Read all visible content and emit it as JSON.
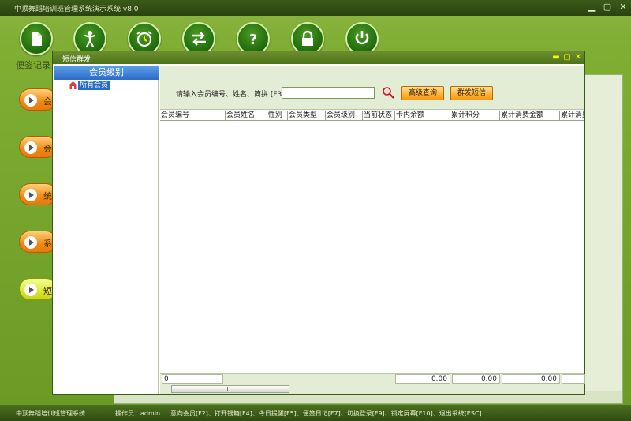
{
  "app": {
    "title": "中顶舞蹈培训班管理系统演示系统  v8.0",
    "controls": [
      "▁",
      "▢",
      "✕"
    ]
  },
  "top_icons": [
    {
      "name": "document-icon"
    },
    {
      "name": "person-icon"
    },
    {
      "name": "alarm-clock-icon"
    },
    {
      "name": "switch-arrows-icon"
    },
    {
      "name": "help-icon"
    },
    {
      "name": "lock-icon"
    },
    {
      "name": "power-icon"
    }
  ],
  "sidebar": {
    "label_top": "便签记录",
    "buttons": [
      {
        "label": "会",
        "style": "orange"
      },
      {
        "label": "会",
        "style": "orange"
      },
      {
        "label": "统",
        "style": "orange"
      },
      {
        "label": "系",
        "style": "orange"
      },
      {
        "label": "短",
        "style": "yellow"
      }
    ]
  },
  "dialog": {
    "title": "短信群发",
    "controls": [
      "▬",
      "▢",
      "✕"
    ],
    "tree": {
      "header": "会员级别",
      "items": [
        "所有会员"
      ]
    },
    "search": {
      "label": "请输入会员编号、姓名、简拼 [F3]",
      "value": "",
      "advanced_button": "高级查询",
      "send_button": "群发短信"
    },
    "grid": {
      "columns": [
        "会员编号",
        "会员姓名",
        "性别",
        "会员类型",
        "会员级别",
        "当前状态",
        "卡内余额",
        "累计积分",
        "累计消费金额",
        "累计消费"
      ],
      "rows": []
    },
    "footer": {
      "count": "0",
      "balance": "0.00",
      "points": "0.00",
      "consumption": "0.00"
    }
  },
  "status_bar": {
    "system_name": "中顶舞蹈培训班管理系统",
    "operator": "操作员：admin",
    "shortcuts": "意向会员[F2]、打开钱箱[F4]、今日提醒[F5]、便签日记[F7]、切换登录[F9]、锁定屏幕[F10]、退出系统[ESC]"
  },
  "colors": {
    "accent_green": "#1f6a0c",
    "tree_header_blue": "#2a6cc9",
    "button_orange": "#ffb53a"
  }
}
